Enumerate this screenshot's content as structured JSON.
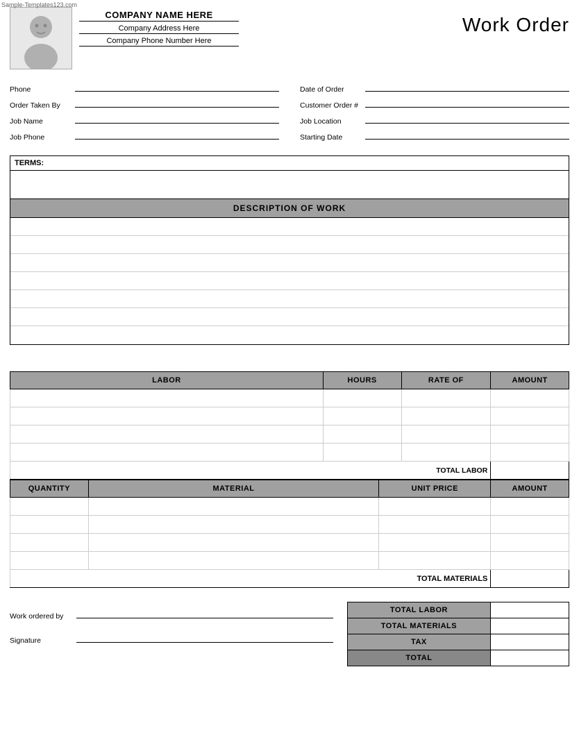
{
  "watermark": "Sample-Templates123.com",
  "header": {
    "company_name": "COMPANY NAME HERE",
    "company_address": "Company Address Here",
    "company_phone": "Company Phone Number Here",
    "title": "Work Order"
  },
  "form": {
    "left": [
      {
        "label": "Phone",
        "value": ""
      },
      {
        "label": "Order Taken By",
        "value": ""
      },
      {
        "label": "Job Name",
        "value": ""
      },
      {
        "label": "Job Phone",
        "value": ""
      }
    ],
    "right": [
      {
        "label": "Date of Order",
        "value": ""
      },
      {
        "label": "Customer Order #",
        "value": ""
      },
      {
        "label": "Job Location",
        "value": ""
      },
      {
        "label": "Starting Date",
        "value": ""
      }
    ]
  },
  "terms": {
    "label": "TERMS:"
  },
  "description": {
    "header": "DESCRIPTION OF WORK",
    "rows": 7
  },
  "labor": {
    "columns": [
      "LABOR",
      "HOURS",
      "RATE OF",
      "AMOUNT"
    ],
    "col_widths": [
      "56%",
      "14%",
      "16%",
      "14%"
    ],
    "rows": 4,
    "total_label": "TOTAL LABOR"
  },
  "materials": {
    "columns": [
      "QUANTITY",
      "MATERIAL",
      "UNIT PRICE",
      "AMOUNT"
    ],
    "col_widths": [
      "14%",
      "52%",
      "20%",
      "14%"
    ],
    "rows": 4,
    "total_label": "TOTAL MATERIALS"
  },
  "summary": {
    "work_ordered_by_label": "Work ordered by",
    "signature_label": "Signature",
    "totals": [
      {
        "label": "TOTAL LABOR",
        "value": ""
      },
      {
        "label": "TOTAL MATERIALS",
        "value": ""
      },
      {
        "label": "TAX",
        "value": ""
      },
      {
        "label": "TOTAL",
        "value": "",
        "final": true
      }
    ]
  }
}
